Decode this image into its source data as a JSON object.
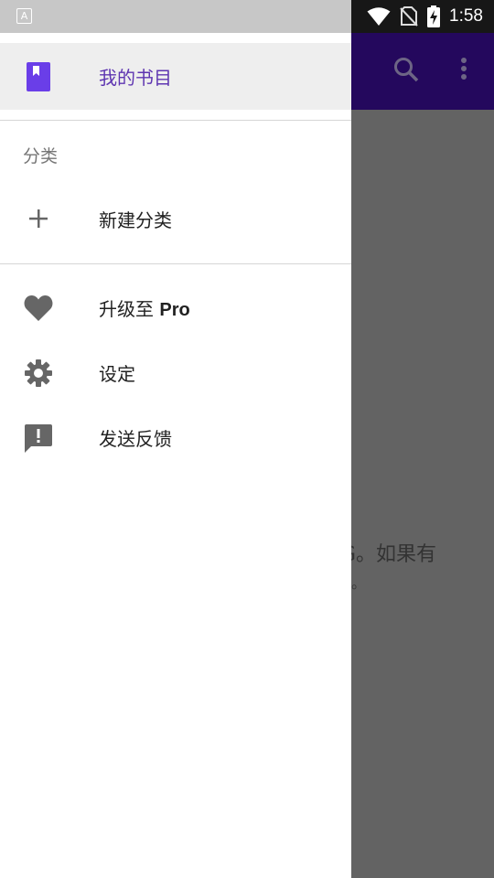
{
  "status_bar": {
    "time": "1:58",
    "app_icon_letter": "A",
    "icons": [
      "wifi-icon",
      "no-sim-icon",
      "battery-charging-icon"
    ]
  },
  "app_bar": {
    "actions": [
      "search-icon",
      "more-vert-icon"
    ]
  },
  "background_content": {
    "text_line_1": "G。如果有",
    "text_line_2": "。"
  },
  "drawer": {
    "selected_item": {
      "label": "我的书目",
      "icon": "bookshelf-icon"
    },
    "category_section": {
      "title": "分类",
      "new_category_label": "新建分类"
    },
    "items": [
      {
        "label_prefix": "升级至 ",
        "label_bold": "Pro",
        "icon": "heart-icon"
      },
      {
        "label": "设定",
        "icon": "gear-icon"
      },
      {
        "label": "发送反馈",
        "icon": "feedback-icon"
      }
    ]
  },
  "colors": {
    "accent": "#6a3ee8",
    "app_bar": "#3a0ea0",
    "scrim": "#636363"
  }
}
